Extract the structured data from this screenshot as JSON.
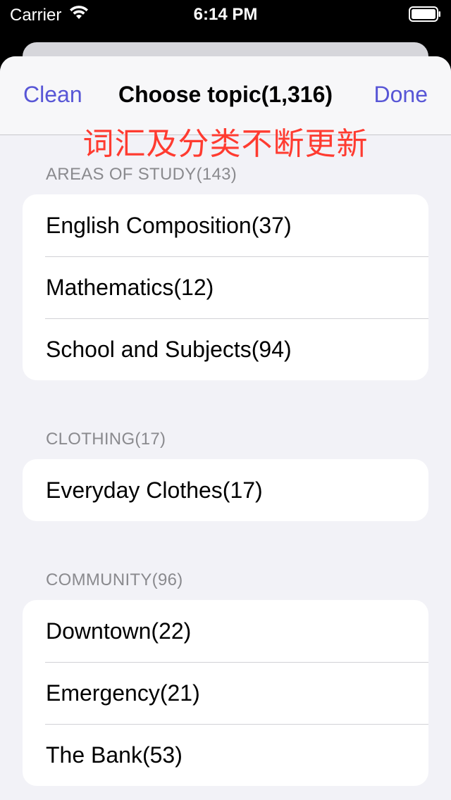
{
  "status_bar": {
    "carrier": "Carrier",
    "time": "6:14 PM",
    "wifi_icon": "wifi-icon",
    "battery_icon": "battery-icon"
  },
  "nav": {
    "left_label": "Clean",
    "title": "Choose topic(1,316)",
    "right_label": "Done"
  },
  "banner": "词汇及分类不断更新",
  "colors": {
    "accent": "#5856d6",
    "banner": "#ff3b30",
    "background": "#f2f2f7",
    "section_header": "#8a8a8e"
  },
  "sections": [
    {
      "header": "AREAS OF STUDY(143)",
      "items": [
        "English Composition(37)",
        "Mathematics(12)",
        "School and Subjects(94)"
      ]
    },
    {
      "header": "CLOTHING(17)",
      "items": [
        "Everyday Clothes(17)"
      ]
    },
    {
      "header": "COMMUNITY(96)",
      "items": [
        "Downtown(22)",
        "Emergency(21)",
        "The Bank(53)"
      ]
    }
  ]
}
